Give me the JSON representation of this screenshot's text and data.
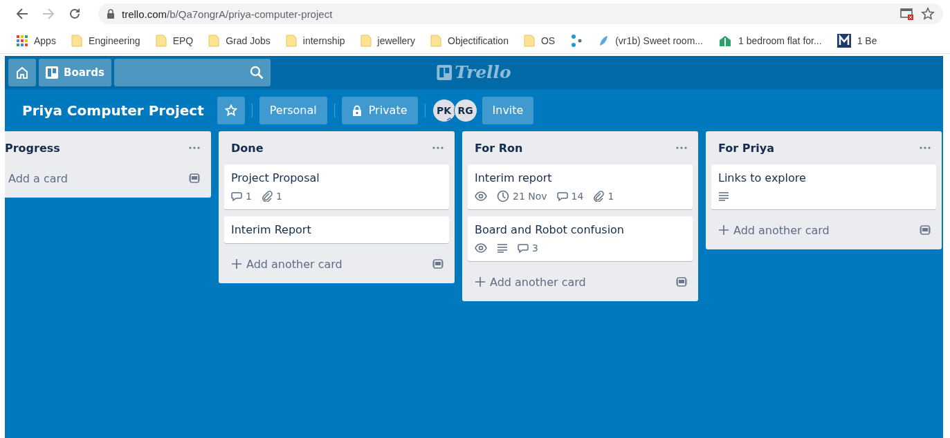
{
  "browser": {
    "back_disabled": false,
    "forward_disabled": true,
    "url_host": "trello.com",
    "url_path": "/b/Qa7ongrA/priya-computer-project"
  },
  "bookmarks": [
    {
      "kind": "apps",
      "label": "Apps"
    },
    {
      "kind": "folder",
      "label": "Engineering"
    },
    {
      "kind": "folder",
      "label": "EPQ"
    },
    {
      "kind": "folder",
      "label": "Grad Jobs"
    },
    {
      "kind": "folder",
      "label": "internship"
    },
    {
      "kind": "folder",
      "label": "jewellery"
    },
    {
      "kind": "folder",
      "label": "Objectification"
    },
    {
      "kind": "folder",
      "label": "OS"
    },
    {
      "kind": "dots"
    },
    {
      "kind": "site",
      "label": "(vr1b) Sweet room..."
    },
    {
      "kind": "house",
      "label": "1 bedroom flat for..."
    },
    {
      "kind": "m",
      "label": "1 Be"
    }
  ],
  "header": {
    "boards_label": "Boards",
    "logo": "Trello"
  },
  "board": {
    "title": "Priya Computer Project",
    "starred": false,
    "team": "Personal",
    "visibility": "Private",
    "members": [
      {
        "initials": "PK",
        "admin": true
      },
      {
        "initials": "RG",
        "admin": false
      }
    ],
    "invite": "Invite"
  },
  "lists": [
    {
      "kind": "cut",
      "title": "Progress",
      "add_label": "Add a card",
      "add_plus": false
    },
    {
      "kind": "full",
      "title": "Done",
      "cards": [
        {
          "title": "Project Proposal",
          "badges": [
            {
              "kind": "comments",
              "text": "1"
            },
            {
              "kind": "attachments",
              "text": "1"
            }
          ]
        },
        {
          "title": "Interim Report"
        }
      ],
      "add_label": "Add another card",
      "add_plus": true
    },
    {
      "kind": "full",
      "title": "For Ron",
      "cards": [
        {
          "title": "Interim report",
          "badges": [
            {
              "kind": "watch"
            },
            {
              "kind": "due",
              "text": "21 Nov"
            },
            {
              "kind": "comments",
              "text": "14"
            },
            {
              "kind": "attachments",
              "text": "1"
            }
          ]
        },
        {
          "title": "Board and Robot confusion",
          "badges": [
            {
              "kind": "watch"
            },
            {
              "kind": "description"
            },
            {
              "kind": "comments",
              "text": "3"
            }
          ]
        }
      ],
      "add_label": "Add another card",
      "add_plus": true
    },
    {
      "kind": "full",
      "title": "For Priya",
      "cards": [
        {
          "title": "Links to explore",
          "badges": [
            {
              "kind": "description"
            }
          ]
        }
      ],
      "add_label": "Add another card",
      "add_plus": true
    }
  ]
}
